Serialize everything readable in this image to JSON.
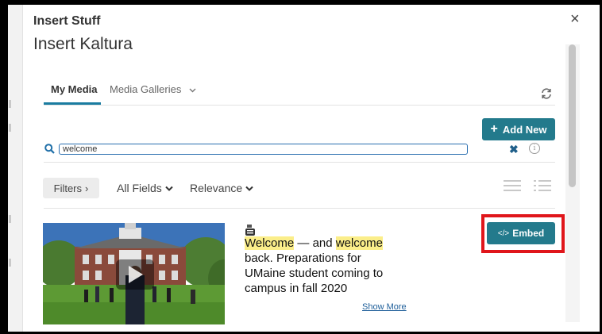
{
  "dialog": {
    "title": "Insert Stuff",
    "subtitle": "Insert Kaltura",
    "close_glyph": "×"
  },
  "tabs": [
    {
      "label": "My Media",
      "active": true
    },
    {
      "label": "Media Galleries",
      "active": false
    }
  ],
  "toolbar": {
    "add_new_label": "Add New",
    "add_new_glyph": "+",
    "refresh_icon": "refresh-icon"
  },
  "search": {
    "value": "welcome",
    "clear_glyph": "✖",
    "info_glyph": "i"
  },
  "filters": {
    "filters_label": "Filters",
    "filters_chevron": "›",
    "fields_label": "All Fields",
    "sort_label": "Relevance",
    "caret": "⌄",
    "view_icons": [
      "list-view-icon",
      "detail-view-icon"
    ]
  },
  "entry": {
    "source_icon": "youtube-icon",
    "title_highlight_1": "Welcome",
    "title_mid": " — and ",
    "title_highlight_2": "welcome",
    "title_rest": " back. Preparations for UMaine student coming to campus in fall 2020",
    "embed_label": "Embed",
    "embed_glyph": "</>",
    "show_more": "Show More"
  },
  "colors": {
    "accent": "#237a8c",
    "highlight": "#fbee8a",
    "callout": "#e0161b",
    "tab_underline": "#1a7ca0"
  }
}
